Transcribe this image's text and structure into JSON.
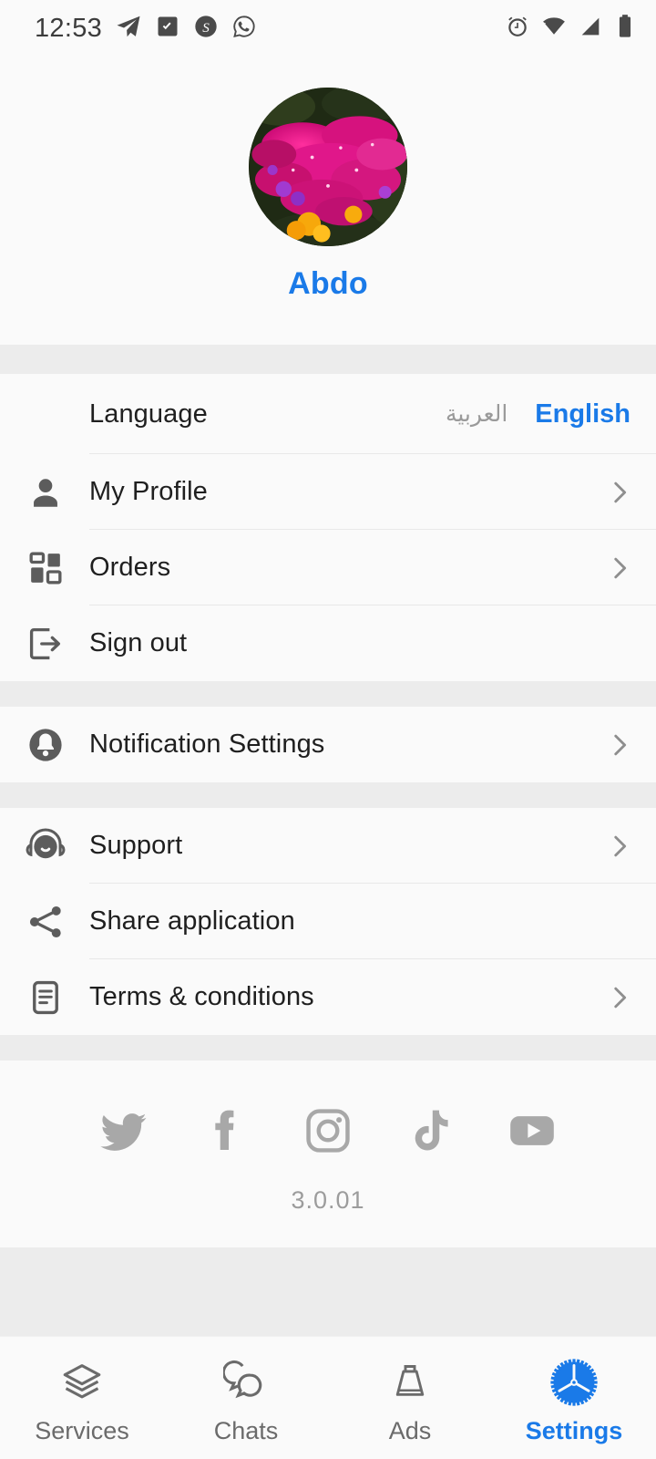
{
  "statusbar": {
    "time": "12:53",
    "left_icons": [
      "telegram-icon",
      "screenshot-icon",
      "skype-icon",
      "whatsapp-icon"
    ],
    "right_icons": [
      "alarm-icon",
      "wifi-icon",
      "cellular-signal-icon",
      "battery-icon"
    ]
  },
  "profile": {
    "avatar_alt": "flower-photo-avatar",
    "username": "Abdo",
    "username_color": "#1a7ae8"
  },
  "language": {
    "label": "Language",
    "arabic_label": "العربية",
    "english_label": "English",
    "selected": "English"
  },
  "account_items": [
    {
      "label": "My Profile",
      "icon": "person-icon",
      "chevron": true
    },
    {
      "label": "Orders",
      "icon": "dashboard-grid-icon",
      "chevron": true
    },
    {
      "label": "Sign out",
      "icon": "sign-out-icon",
      "chevron": false
    }
  ],
  "notification_items": [
    {
      "label": "Notification Settings",
      "icon": "bell-icon",
      "chevron": true
    }
  ],
  "info_items": [
    {
      "label": "Support",
      "icon": "headset-support-icon",
      "chevron": true
    },
    {
      "label": "Share application",
      "icon": "share-icon",
      "chevron": false
    },
    {
      "label": "Terms & conditions",
      "icon": "document-icon",
      "chevron": true
    }
  ],
  "socials": [
    {
      "name": "twitter-icon"
    },
    {
      "name": "facebook-icon"
    },
    {
      "name": "instagram-icon"
    },
    {
      "name": "tiktok-icon"
    },
    {
      "name": "youtube-icon"
    }
  ],
  "version": "3.0.01",
  "bottom_nav": {
    "active": "Settings",
    "items": [
      {
        "label": "Services",
        "icon": "layers-icon",
        "active": false
      },
      {
        "label": "Chats",
        "icon": "chat-bubbles-icon",
        "active": false
      },
      {
        "label": "Ads",
        "icon": "bag-icon",
        "active": false
      },
      {
        "label": "Settings",
        "icon": "gear-icon",
        "active": true
      }
    ]
  },
  "colors": {
    "accent": "#1a7ae8",
    "separator": "#ececec",
    "surface": "#fafafa",
    "text": "#1f1f1f",
    "muted": "#9a9a9a"
  }
}
